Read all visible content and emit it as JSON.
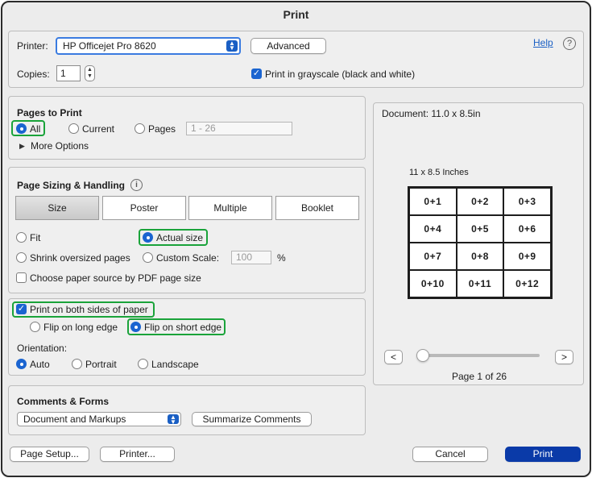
{
  "window": {
    "title": "Print"
  },
  "printer": {
    "label": "Printer:",
    "selected": "HP Officejet Pro 8620",
    "advanced_label": "Advanced",
    "help_label": "Help",
    "help_icon": "?",
    "copies_label": "Copies:",
    "copies_value": "1",
    "grayscale_label": "Print in grayscale (black and white)",
    "grayscale_checked": true
  },
  "pages_to_print": {
    "title": "Pages to Print",
    "options": [
      "All",
      "Current",
      "Pages"
    ],
    "selected": "All",
    "range_placeholder": "1 - 26",
    "more_options_label": "More Options"
  },
  "page_sizing": {
    "title": "Page Sizing & Handling",
    "info_icon": "i",
    "tabs": [
      "Size",
      "Poster",
      "Multiple",
      "Booklet"
    ],
    "selected_tab": "Size",
    "fit_label": "Fit",
    "actual_size_label": "Actual size",
    "shrink_label": "Shrink oversized pages",
    "custom_scale_label": "Custom Scale:",
    "custom_scale_value": "100",
    "percent_label": "%",
    "paper_source_label": "Choose paper source by PDF page size",
    "selected_option": "Actual size"
  },
  "duplex": {
    "both_sides_label": "Print on both sides of paper",
    "both_sides_checked": true,
    "flip_long_label": "Flip on long edge",
    "flip_short_label": "Flip on short edge",
    "selected_flip": "Flip on short edge",
    "orientation_label": "Orientation:",
    "orientation_options": [
      "Auto",
      "Portrait",
      "Landscape"
    ],
    "selected_orientation": "Auto"
  },
  "comments_forms": {
    "title": "Comments & Forms",
    "selected": "Document and Markups",
    "summarize_label": "Summarize Comments"
  },
  "preview": {
    "document_label": "Document: 11.0 x 8.5in",
    "paper_label": "11 x 8.5 Inches",
    "cells": [
      "0+1",
      "0+2",
      "0+3",
      "0+4",
      "0+5",
      "0+6",
      "0+7",
      "0+8",
      "0+9",
      "0+10",
      "0+11",
      "0+12"
    ],
    "prev_label": "<",
    "next_label": ">",
    "page_info": "Page 1 of 26",
    "slider_position": 0
  },
  "footer": {
    "page_setup_label": "Page Setup...",
    "printer_label": "Printer...",
    "cancel_label": "Cancel",
    "print_label": "Print"
  },
  "colors": {
    "accent": "#1a64d0",
    "print_button": "#0a3aa8",
    "highlight": "#1aa33a",
    "window_bg": "#ececec"
  }
}
